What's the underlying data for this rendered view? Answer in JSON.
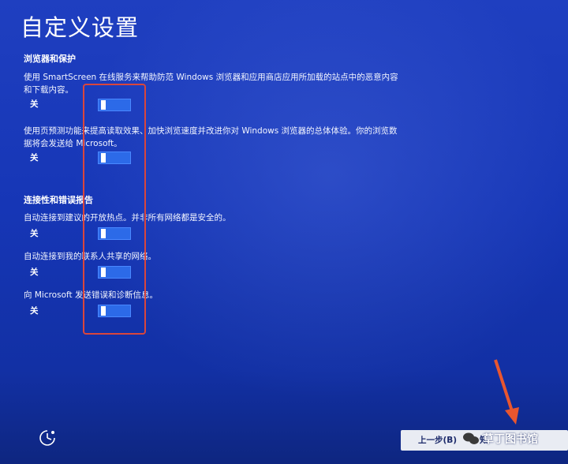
{
  "page": {
    "title": "自定义设置"
  },
  "sections": [
    {
      "heading": "浏览器和保护",
      "items": [
        {
          "line1": "使用 SmartScreen 在线服务来帮助防范 Windows 浏览器和应用商店应用所加载的站点中的恶意内容",
          "line2": "和下载内容。",
          "state": "关"
        },
        {
          "line1": "使用页预测功能来提高读取效果、加快浏览速度并改进你对 Windows 浏览器的总体体验。你的浏览数",
          "line2": "据将会发送给 Microsoft。",
          "state": "关"
        }
      ]
    },
    {
      "heading": "连接性和错误报告",
      "items": [
        {
          "line1": "自动连接到建议的开放热点。并非所有网络都是安全的。",
          "state": "关"
        },
        {
          "line1": "自动连接到我的联系人共享的网络。",
          "state": "关"
        },
        {
          "line1": "向 Microsoft 发送错误和诊断信息。",
          "state": "关"
        }
      ]
    }
  ],
  "footer": {
    "back_label": "上一步(B)",
    "next_label": "知",
    "watermark": "草丁图书馆"
  },
  "toggles": {
    "state": "off"
  },
  "icons": {
    "ease": "ease-of-access-icon",
    "arrow": "pointer-arrow",
    "watermark": "wechat-icon"
  },
  "colors": {
    "background": "#1636b6",
    "highlight": "#d9463c",
    "toggle": "#2c6ae8",
    "arrow": "#e8562f"
  }
}
